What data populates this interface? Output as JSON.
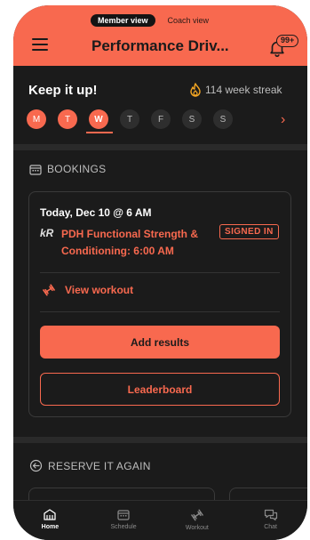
{
  "header": {
    "view_toggle": {
      "member": "Member view",
      "coach": "Coach view"
    },
    "title": "Performance Driv...",
    "notifications_badge": "99+",
    "accent_color": "#f8694f"
  },
  "streak": {
    "message": "Keep it up!",
    "streak_text": "114 week streak",
    "days": [
      {
        "label": "M",
        "state": "done"
      },
      {
        "label": "T",
        "state": "done"
      },
      {
        "label": "W",
        "state": "today"
      },
      {
        "label": "T",
        "state": "upcoming"
      },
      {
        "label": "F",
        "state": "upcoming"
      },
      {
        "label": "S",
        "state": "upcoming"
      },
      {
        "label": "S",
        "state": "upcoming"
      }
    ]
  },
  "bookings": {
    "section_title": "BOOKINGS",
    "card": {
      "date": "Today, Dec 10 @ 6 AM",
      "logo": "kR",
      "class_name": "PDH Functional Strength & Conditioning: 6:00 AM",
      "status": "SIGNED IN",
      "view_workout": "View workout",
      "add_results": "Add results",
      "leaderboard": "Leaderboard"
    }
  },
  "reserve": {
    "section_title": "RESERVE IT AGAIN"
  },
  "tabbar": {
    "items": [
      {
        "label": "Home",
        "icon": "home-icon",
        "active": true
      },
      {
        "label": "Schedule",
        "icon": "calendar-icon",
        "active": false
      },
      {
        "label": "Workout",
        "icon": "dumbbell-icon",
        "active": false
      },
      {
        "label": "Chat",
        "icon": "chat-icon",
        "active": false
      }
    ]
  }
}
